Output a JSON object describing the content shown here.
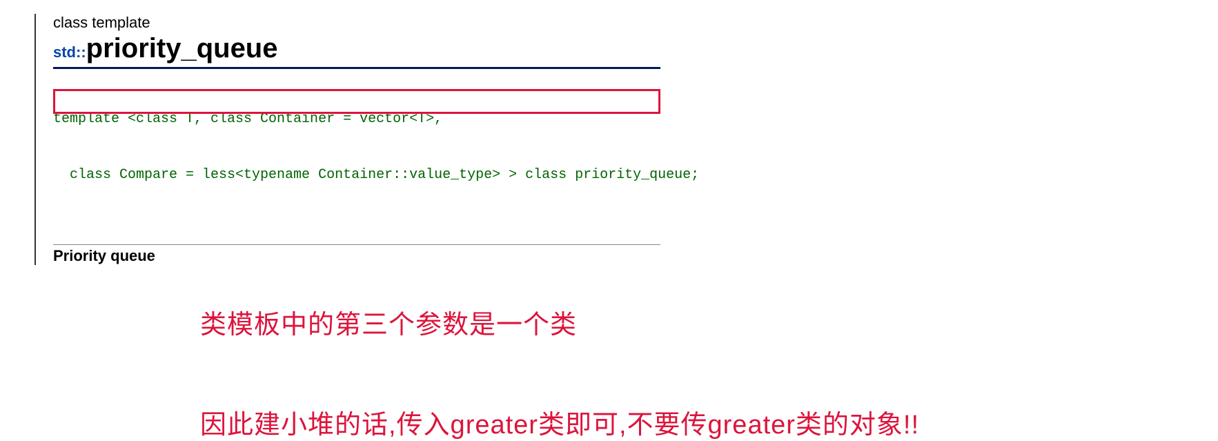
{
  "doc": {
    "kind": "class template",
    "namespace": "std::",
    "name": "priority_queue",
    "code_line1": "template <class T, class Container = vector<T>,",
    "code_line2": "  class Compare = less<typename Container::value_type> > class priority_queue;",
    "subtitle": "Priority queue"
  },
  "annotations": {
    "line1": "类模板中的第三个参数是一个类",
    "line2": "因此建小堆的话,传入greater类即可,不要传greater类的对象!!"
  }
}
